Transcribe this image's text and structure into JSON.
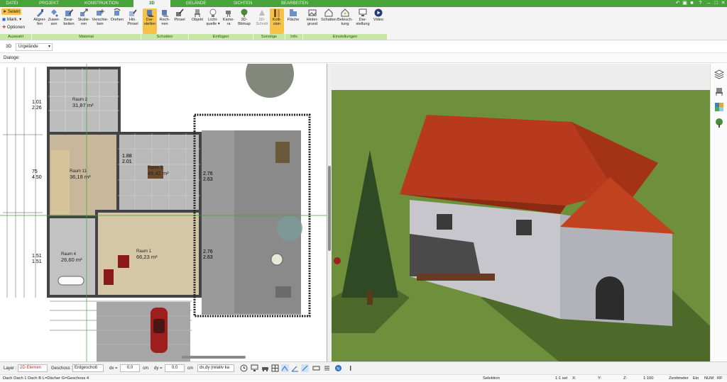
{
  "menu": {
    "tabs": [
      "DATEI",
      "PROJEKT",
      "KONSTRUKTION",
      "3D",
      "GELÄNDE",
      "SICHTEN",
      "BEARBEITEN"
    ],
    "active_tab": "3D"
  },
  "ribbon": {
    "auswahl": {
      "select_label": "Selekt",
      "mark_label": "Mark.",
      "options_label": "Optionen"
    },
    "material": [
      {
        "label": "Aligrei-\nfen",
        "icon": "eyedropper-icon"
      },
      {
        "label": "Zuwei-\nsen",
        "icon": "paint-bucket-icon"
      },
      {
        "label": "Bear-\nbeiten",
        "icon": "edit-material-icon"
      },
      {
        "label": "Skalie-\nren",
        "icon": "scale-icon"
      },
      {
        "label": "Verschie-\nben",
        "icon": "move-icon"
      },
      {
        "label": "Drehen",
        "icon": "rotate-icon"
      },
      {
        "label": "Hin.\nPinsel",
        "icon": "brush-icon"
      }
    ],
    "schatten": [
      {
        "label": "Dar-\nstellen",
        "icon": "display-shadow-icon",
        "active": true
      },
      {
        "label": "Rech-\nnen",
        "icon": "calculate-shadow-icon"
      },
      {
        "label": "Pinsel",
        "icon": "shadow-brush-icon"
      }
    ],
    "einfuegen": [
      {
        "label": "Objekt",
        "icon": "chair-icon"
      },
      {
        "label": "Licht-\nquelle ▾",
        "icon": "bulb-icon"
      },
      {
        "label": "Kame-\nra",
        "icon": "camera-icon"
      },
      {
        "label": "3D-\nBitmap",
        "icon": "tree-icon"
      }
    ],
    "sonstige": [
      {
        "label": "3D-\nSchnitt",
        "icon": "section-icon"
      },
      {
        "label": "Kolli-\nsion",
        "icon": "collision-icon",
        "active": true
      }
    ],
    "info": [
      {
        "label": "Fläche",
        "icon": "area-icon"
      }
    ],
    "einstellungen": [
      {
        "label": "Hinter-\ngrund",
        "icon": "background-icon"
      },
      {
        "label": "Schatten",
        "icon": "shadow-house-icon"
      },
      {
        "label": "Beleuch-\ntung",
        "icon": "lighting-icon"
      },
      {
        "label": "Dar-\nstellung",
        "icon": "monitor-icon"
      },
      {
        "label": "Video",
        "icon": "video-icon"
      }
    ],
    "groups": [
      "Auswahl",
      "Material",
      "Schatten",
      "Einfügen",
      "Sonstige",
      "Info",
      "Einstellungen"
    ]
  },
  "toolbar2": {
    "mode": "3D",
    "terrain_select": "Urgelände"
  },
  "panel_label": "Dialoge:",
  "plan": {
    "rooms": [
      {
        "name": "Raum 2",
        "area": "31,87 m²"
      },
      {
        "name": "Raum 11",
        "area": "36,18 m²"
      },
      {
        "name": "Raum 3",
        "area": "45,42 m²"
      },
      {
        "name": "Raum 1",
        "area": "66,23 m²"
      },
      {
        "name": "Raum 4",
        "area": "26,60 m²"
      }
    ],
    "dims": [
      "1.01",
      "2.26",
      "75",
      "4.50",
      "1.51",
      "1.51",
      "1.88",
      "2.01",
      "2.76",
      "2.63",
      "2.76",
      "2.63"
    ]
  },
  "statusbar": {
    "layer_label": "Layer :",
    "layer_value": "2D-Elemen",
    "floor_label": "Geschoss :",
    "floor_value": "Erdgeschoß",
    "dx_label": "dx =",
    "dx_value": "0,0",
    "dy_label": "dy =",
    "dy_value": "0,0",
    "unit": "cm",
    "relative_value": "dx,dy (relativ ka"
  },
  "infobar": {
    "status_text": "Dach Dach 1 Dach B L=Dächer G=Geschoss 4",
    "mode": "Selektion",
    "selection": "1:1 sel",
    "x_label": "X:",
    "y_label": "Y:",
    "z_label": "Z:",
    "scale": "1:100",
    "unit": "Zentimeter",
    "ein": "Ein",
    "num": "NUM",
    "rf": "RF"
  },
  "colors": {
    "menubar": "#49a33b",
    "ribbon_group_label": "#c8e6a4",
    "highlight": "#f6c24a",
    "roof": "#b83a1e",
    "grass": "#6e8f3c",
    "sky": "#ededed"
  }
}
